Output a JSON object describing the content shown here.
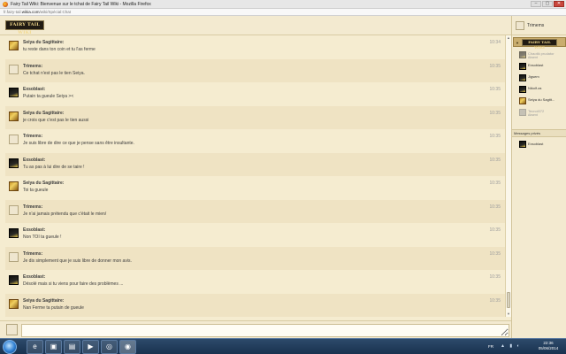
{
  "window": {
    "title": "Fairy Tail Wiki: Bienvenue sur le tchat de Fairy Tail Wiki - Mozilla Firefox",
    "url_prefix": "fr.fairy-tail.",
    "url_domain": "wikia.com",
    "url_path": "/wiki/Spécial:Chat",
    "controls": [
      "–",
      "▢",
      "✕"
    ]
  },
  "header": {
    "wordmark": "FAIRY TAIL WIKI"
  },
  "messages": [
    {
      "author": "Seiya du Sagittaire:",
      "text": "tu reste dans ton coin et tu l'as ferme",
      "time": "10:34",
      "avatar": "seiya"
    },
    {
      "author": "Trimems:",
      "text": "Ce tchat n'est pas le tien Seiya.",
      "time": "10:35",
      "avatar": "trim"
    },
    {
      "author": "Exsoblast:",
      "text": "Putain ta gueule Seiya ><",
      "time": "10:35",
      "avatar": "exso"
    },
    {
      "author": "Seiya du Sagittaire:",
      "text": "je crois que c'est pas le tien aussi",
      "time": "10:35",
      "avatar": "seiya"
    },
    {
      "author": "Trimems:",
      "text": "Je suis libre de dire ce que je pense sans être insultante.",
      "time": "10:35",
      "avatar": "trim"
    },
    {
      "author": "Exsoblast:",
      "text": "Tu as pas à lui dire de se taire !",
      "time": "10:35",
      "avatar": "exso"
    },
    {
      "author": "Seiya du Sagittaire:",
      "text": "Toi ta gueule",
      "time": "10:35",
      "avatar": "seiya"
    },
    {
      "author": "Trimems:",
      "text": "Je n'ai jamais prétendu que c'était le mien/",
      "time": "10:35",
      "avatar": "trim"
    },
    {
      "author": "Exsoblast:",
      "text": "Non TOI ta gueule !",
      "time": "10:35",
      "avatar": "exso"
    },
    {
      "author": "Trimems:",
      "text": "Je dis simplement que je suis libre de donner mon avis.",
      "time": "10:35",
      "avatar": "trim"
    },
    {
      "author": "Exsoblast:",
      "text": "Désolé mais si tu viens pour faire des problèmes ...",
      "time": "10:35",
      "avatar": "exso"
    },
    {
      "author": "Seiya du Sagittaire:",
      "text": "Nan Ferme ta putain de gueule",
      "time": "10:35",
      "avatar": "seiya"
    }
  ],
  "sidebar": {
    "current_user": "Trimems",
    "room_wordmark": "FAIRY TAIL WIKI",
    "users": [
      {
        "name": "Chaotik prudator",
        "status": "Absent",
        "away": true,
        "avatar": "exso"
      },
      {
        "name": "Exsoblast",
        "status": "",
        "away": false,
        "avatar": "exso"
      },
      {
        "name": "Jigsem",
        "status": "",
        "away": false,
        "avatar": "exso"
      },
      {
        "name": "Nikolf.za",
        "status": "",
        "away": false,
        "avatar": "exso"
      },
      {
        "name": "Seiya du Sagitt...",
        "status": "",
        "away": false,
        "avatar": "seiya"
      },
      {
        "name": "Tecnol072",
        "status": "Absent",
        "away": true,
        "avatar": "guest"
      }
    ],
    "pm_header": "Messages privés",
    "pm_items": [
      {
        "name": "Exsoblast",
        "avatar": "exso"
      }
    ]
  },
  "input": {
    "placeholder": ""
  },
  "taskbar": {
    "buttons": [
      "e",
      "▣",
      "▤",
      "▶",
      "◎",
      "◉"
    ],
    "lang": "FR",
    "tray_icons": "▲ ▮ ◐",
    "time": "22:36",
    "date": "05/06/2014"
  },
  "scroll": {
    "up": "▲",
    "down": "▼"
  }
}
